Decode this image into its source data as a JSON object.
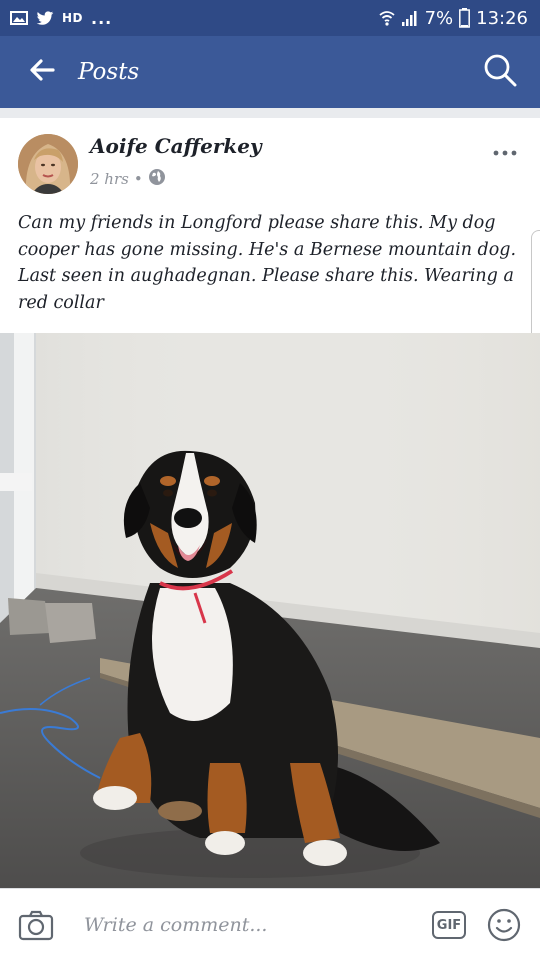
{
  "status_bar": {
    "hd_label": "HD",
    "more": "...",
    "battery": "7%",
    "time": "13:26"
  },
  "app_bar": {
    "title": "Posts"
  },
  "post": {
    "author": "Aoife Cafferkey",
    "time_ago": "2 hrs",
    "separator": "•",
    "privacy_icon": "globe-icon",
    "text": "Can my friends in Longford please share this. My dog cooper has gone missing. He's a Bernese mountain dog. Last seen in aughadegnan. Please share this. Wearing a red collar"
  },
  "comment_bar": {
    "placeholder": "Write a comment...",
    "gif_label": "GIF"
  },
  "colors": {
    "status_bar": "#2f4a86",
    "app_bar": "#3b5998"
  }
}
